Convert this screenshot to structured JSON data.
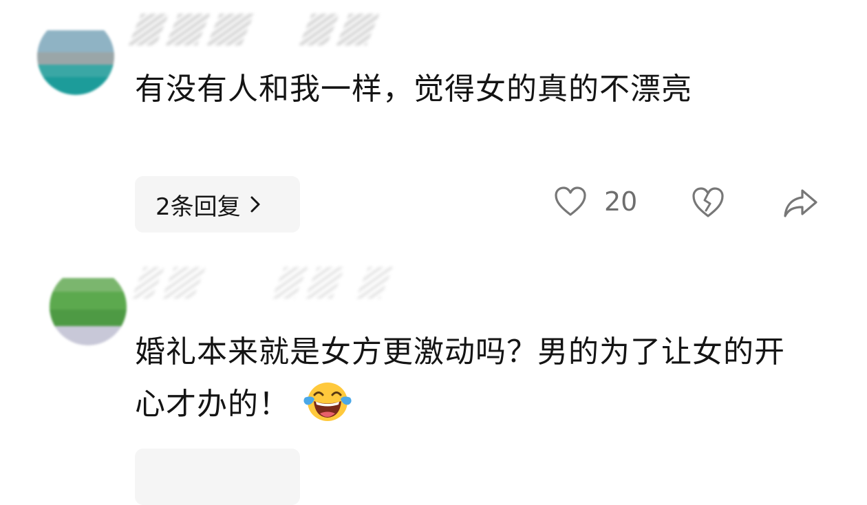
{
  "comments": [
    {
      "text": "有没有人和我一样，觉得女的真的不漂亮",
      "reply_label": "2条回复",
      "like_count": "20",
      "icons": [
        "heart-icon",
        "broken-heart-icon",
        "share-arrow-icon",
        "chevron-right-icon"
      ]
    },
    {
      "text": "婚礼本来就是女方更激动吗？男的为了让女的开心才办的！",
      "emoji": "face-with-tears-of-joy"
    }
  ],
  "colors": {
    "text": "#141414",
    "muted": "#6e6e6e",
    "reply_bg": "#f5f5f5",
    "icon_stroke": "#777777",
    "emoji_face": "#ffc93c"
  }
}
